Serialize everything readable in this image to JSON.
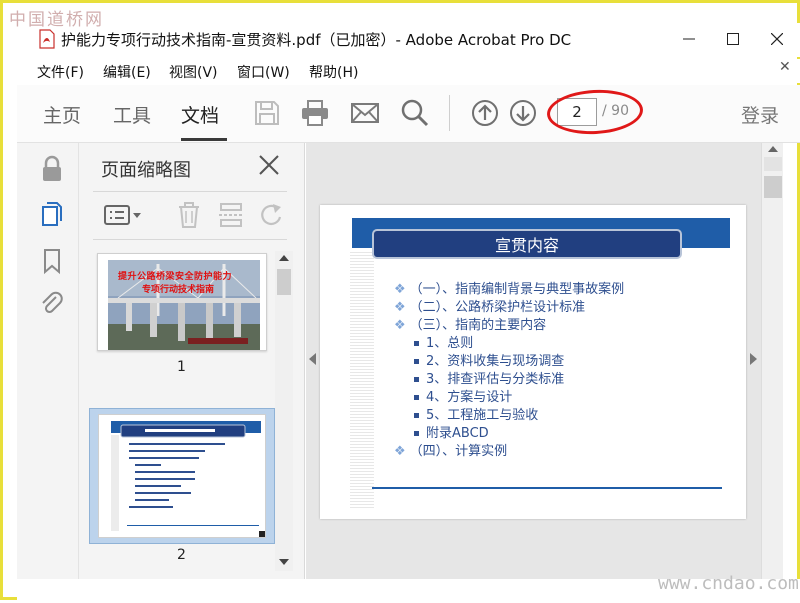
{
  "watermark": {
    "top_left": "中国道桥网",
    "bottom_right": "www.cndao.com"
  },
  "window": {
    "title": "护能力专项行动技术指南-宣贯资料.pdf（已加密）- Adobe Acrobat Pro DC"
  },
  "menu": {
    "items": [
      "文件(F)",
      "编辑(E)",
      "视图(V)",
      "窗口(W)",
      "帮助(H)"
    ]
  },
  "toolbar": {
    "tabs": [
      "主页",
      "工具",
      "文档"
    ],
    "active_tab": "文档",
    "current_page": "2",
    "total_pages": "/ 90",
    "login_label": "登录"
  },
  "thumbnail_panel": {
    "title": "页面缩略图",
    "pages": [
      {
        "label": "1",
        "slide_title_line1": "提升公路桥梁安全防护能力",
        "slide_title_line2": "专项行动技术指南"
      },
      {
        "label": "2",
        "selected": true
      }
    ]
  },
  "slide": {
    "title": "宣贯内容",
    "items": [
      {
        "text": "（一）、指南编制背景与典型事故案例",
        "style": "diamond"
      },
      {
        "text": "（二）、公路桥梁护栏设计标准",
        "style": "diamond"
      },
      {
        "text": "（三）、指南的主要内容",
        "style": "diamond"
      },
      {
        "text": "1、总则",
        "style": "square"
      },
      {
        "text": "2、资料收集与现场调查",
        "style": "square"
      },
      {
        "text": "3、排查评估与分类标准",
        "style": "square"
      },
      {
        "text": "4、方案与设计",
        "style": "square"
      },
      {
        "text": "5、工程施工与验收",
        "style": "square"
      },
      {
        "text": "附录ABCD",
        "style": "square"
      },
      {
        "text": "（四）、计算实例",
        "style": "diamond"
      }
    ]
  },
  "colors": {
    "accent_band": "#1f5da8",
    "title_box": "#213f80",
    "item_text": "#2e4f8f",
    "highlight_ring": "#e01818",
    "frame": "#e8df3a"
  }
}
